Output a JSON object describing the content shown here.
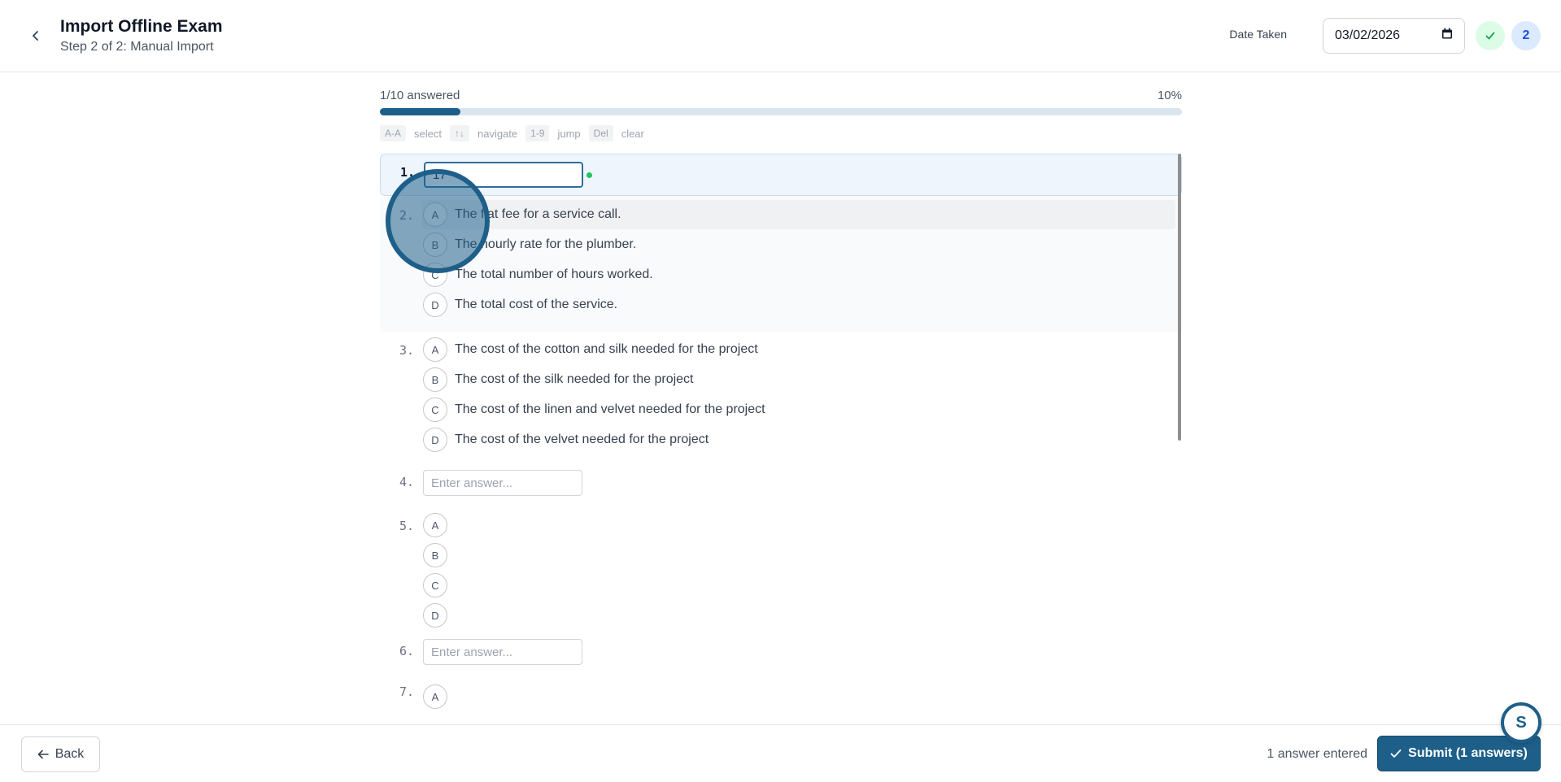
{
  "header": {
    "title": "Import Offline Exam",
    "subtitle": "Step 2 of 2: Manual Import",
    "date_label": "Date Taken",
    "date_value": "03/02/2026",
    "answered_count_badge": "2"
  },
  "progress": {
    "answered_text": "1/10 answered",
    "percent_text": "10%",
    "fraction": 0.1
  },
  "hints": [
    {
      "key": "A-A",
      "word": "select"
    },
    {
      "key": "↑↓",
      "word": "navigate"
    },
    {
      "key": "1-9",
      "word": "jump"
    },
    {
      "key": "Del",
      "word": "clear"
    }
  ],
  "questions": [
    {
      "num": "1.",
      "type": "text",
      "value": "17",
      "placeholder": "Enter answer..."
    },
    {
      "num": "2.",
      "type": "choice",
      "options": [
        {
          "letter": "A",
          "text": "The flat fee for a service call."
        },
        {
          "letter": "B",
          "text": "The hourly rate for the plumber."
        },
        {
          "letter": "C",
          "text": "The total number of hours worked."
        },
        {
          "letter": "D",
          "text": "The total cost of the service."
        }
      ]
    },
    {
      "num": "3.",
      "type": "choice",
      "options": [
        {
          "letter": "A",
          "text": "The cost of the cotton and silk needed for the project"
        },
        {
          "letter": "B",
          "text": "The cost of the silk needed for the project"
        },
        {
          "letter": "C",
          "text": "The cost of the linen and velvet needed for the project"
        },
        {
          "letter": "D",
          "text": "The cost of the velvet needed for the project"
        }
      ]
    },
    {
      "num": "4.",
      "type": "text",
      "value": "",
      "placeholder": "Enter answer..."
    },
    {
      "num": "5.",
      "type": "choice",
      "options": [
        {
          "letter": "A",
          "text": ""
        },
        {
          "letter": "B",
          "text": ""
        },
        {
          "letter": "C",
          "text": ""
        },
        {
          "letter": "D",
          "text": ""
        }
      ]
    },
    {
      "num": "6.",
      "type": "text",
      "value": "",
      "placeholder": "Enter answer..."
    },
    {
      "num": "7.",
      "type": "choice",
      "options": [
        {
          "letter": "A",
          "text": ""
        }
      ]
    }
  ],
  "footer": {
    "back_label": "Back",
    "entered_text": "1 answer entered",
    "submit_label": "Submit (1 answers)"
  },
  "fab_label": "S",
  "colors": {
    "accent": "#1e5f8a",
    "saved": "#22c55e",
    "active_bg": "#eef5fd"
  }
}
